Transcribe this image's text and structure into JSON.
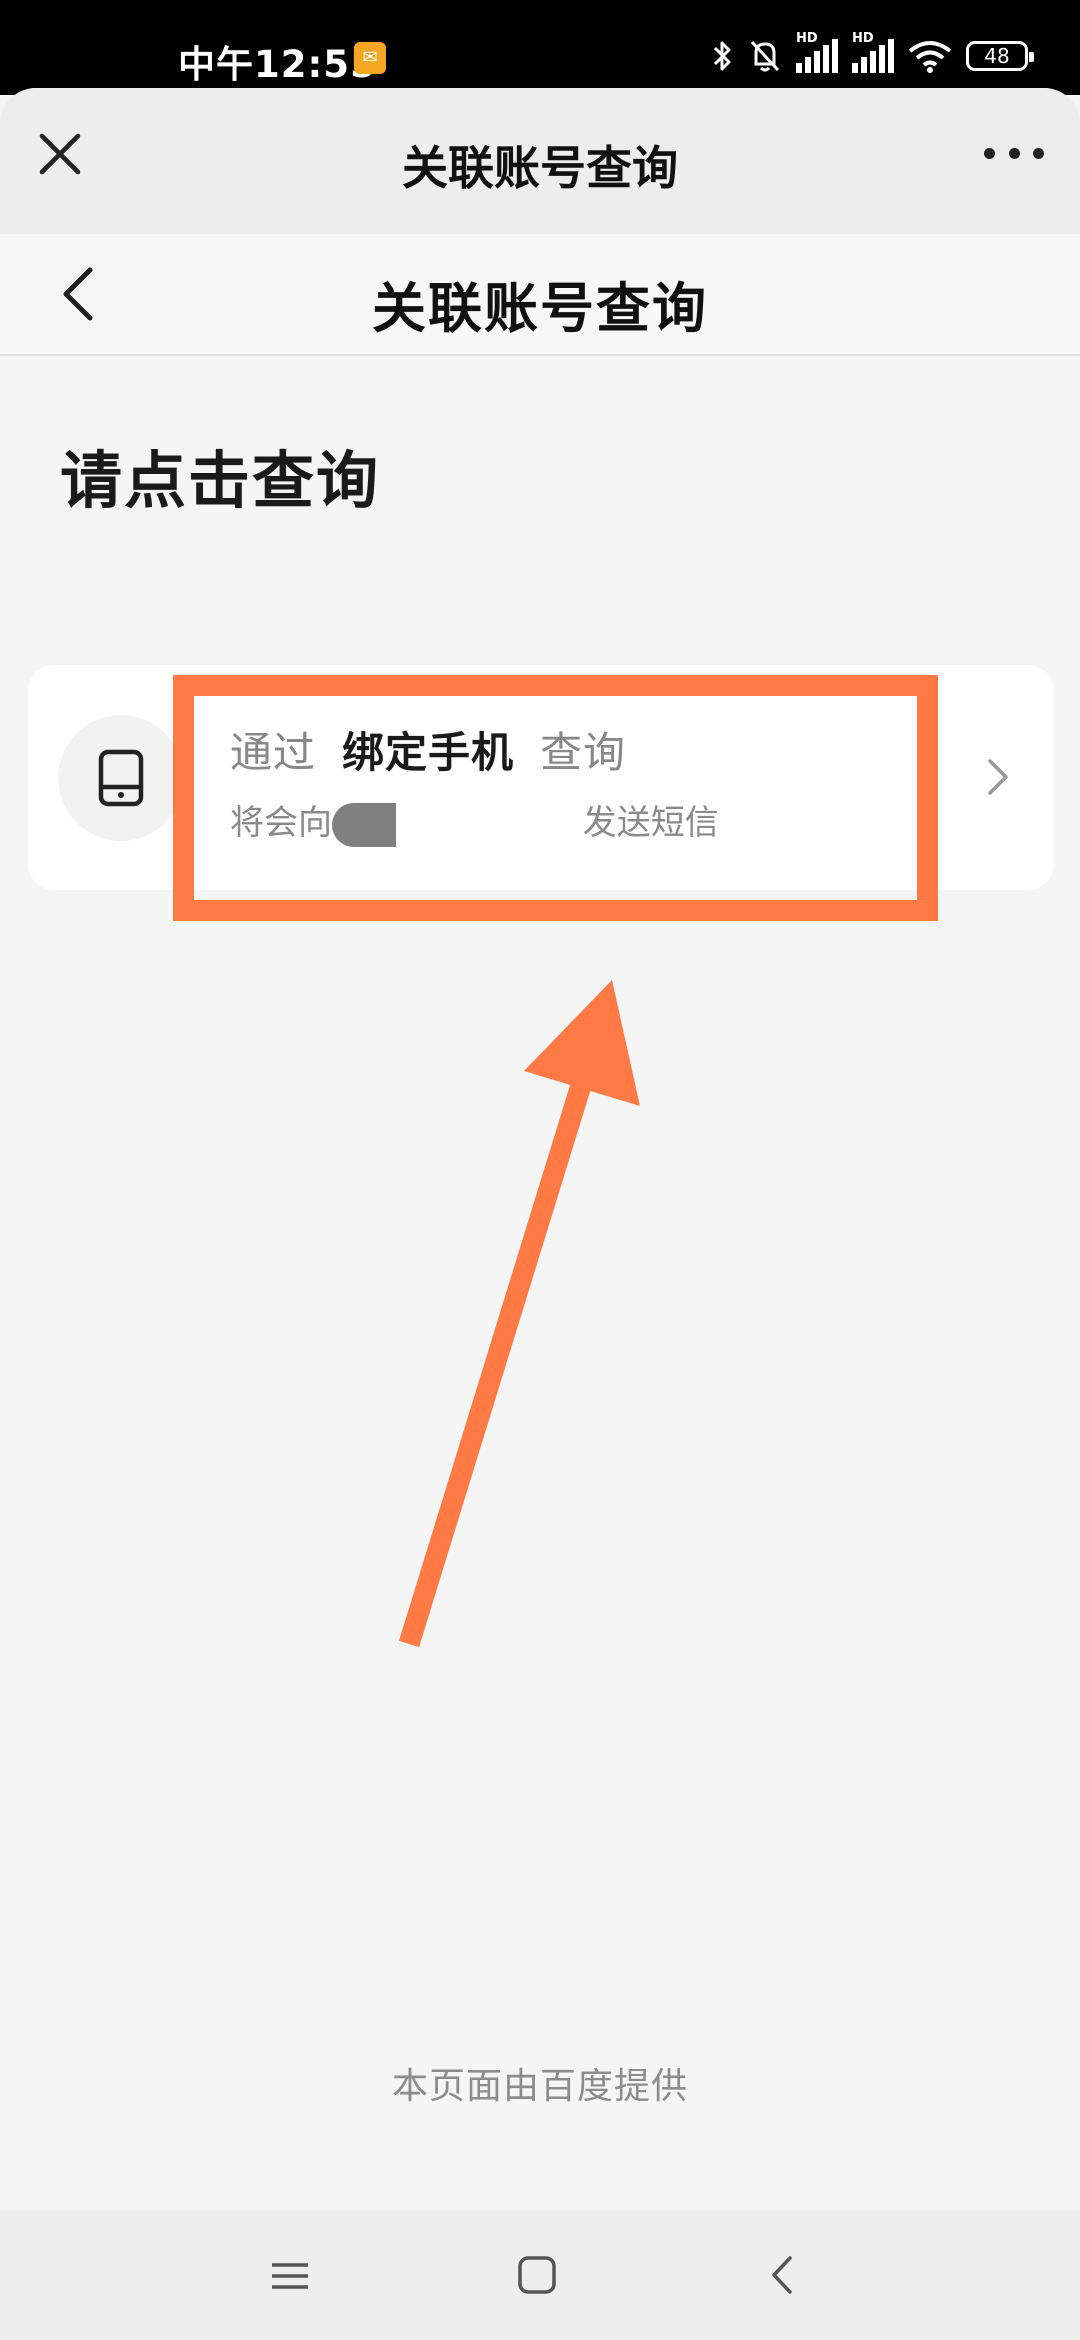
{
  "status_bar": {
    "time": "中午12:55",
    "battery": "48",
    "signal_label": "HD",
    "icons": [
      "bluetooth-icon",
      "mute-bell-icon",
      "signal-icon",
      "signal-icon",
      "wifi-icon",
      "battery-icon"
    ]
  },
  "sheet_header": {
    "title": "关联账号查询",
    "close_icon": "close-icon",
    "more_icon": "more-icon"
  },
  "nav_bar": {
    "title": "关联账号查询",
    "back_icon": "chevron-left-icon"
  },
  "main": {
    "section_title": "请点击查询",
    "option_card": {
      "icon": "phone-icon",
      "title_prefix": "通过",
      "title_emphasis": "绑定手机",
      "title_suffix": "查询",
      "subtitle_prefix": "将会向",
      "subtitle_suffix": " 发送短信",
      "chevron_icon": "chevron-right-icon"
    }
  },
  "annotation": {
    "color": "#ff7a45",
    "box": "highlight-box",
    "arrow": "arrow-pointer"
  },
  "footer": {
    "provided_by": "本页面由百度提供"
  },
  "system_nav": {
    "buttons": [
      "menu-icon",
      "home-icon",
      "back-icon"
    ]
  }
}
